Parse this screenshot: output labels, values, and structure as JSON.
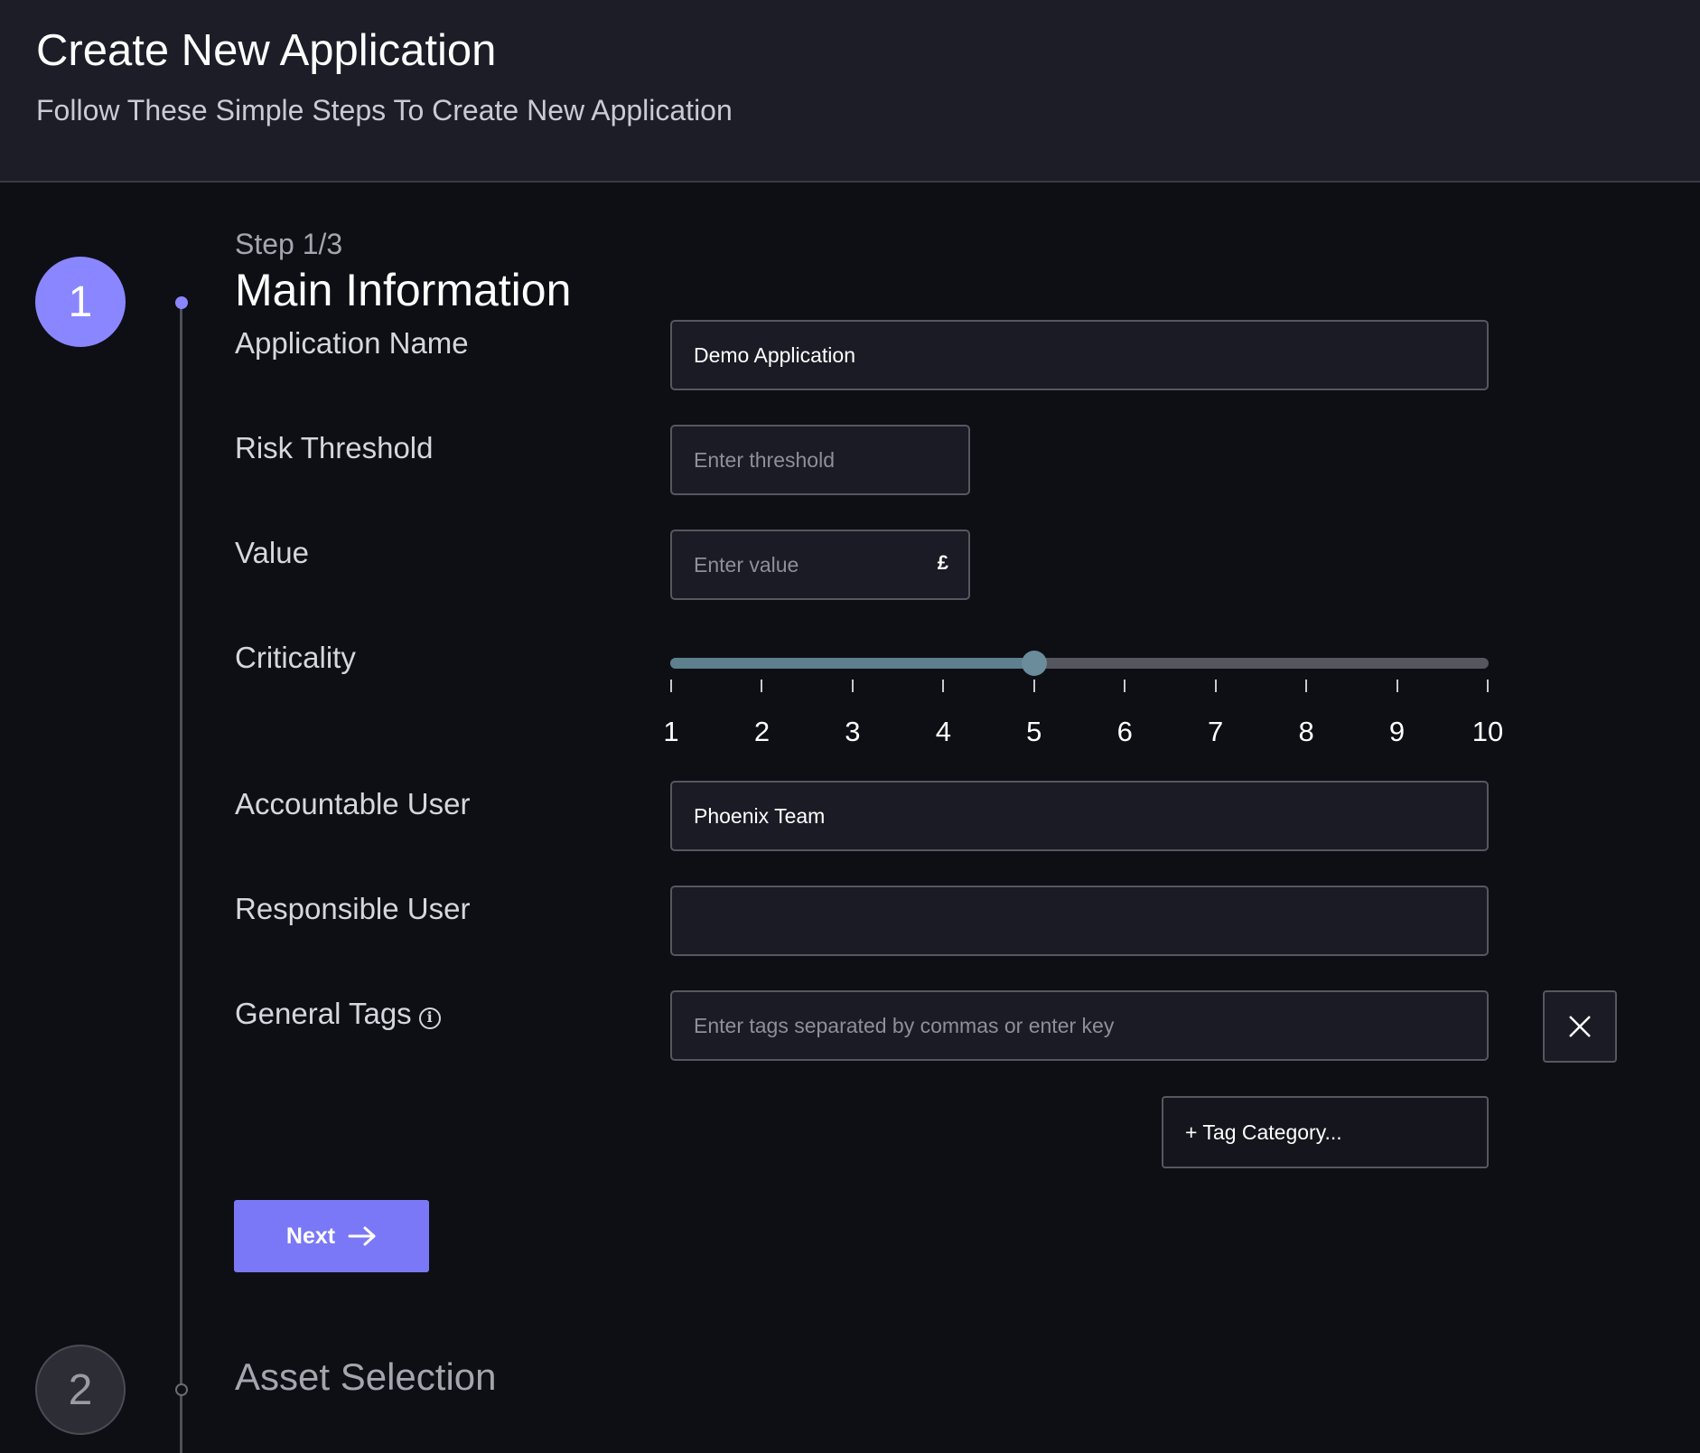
{
  "header": {
    "title": "Create New Application",
    "subtitle": "Follow These Simple Steps To Create New Application"
  },
  "stepper": {
    "active_step_number": "1",
    "counter": "Step 1/3",
    "active_step_title": "Main Information",
    "next_step_number": "2",
    "next_step_title": "Asset Selection"
  },
  "form": {
    "application_name": {
      "label": "Application Name",
      "value": "Demo Application",
      "placeholder": ""
    },
    "risk_threshold": {
      "label": "Risk Threshold",
      "value": "",
      "placeholder": "Enter threshold"
    },
    "value": {
      "label": "Value",
      "value": "",
      "placeholder": "Enter value",
      "currency_symbol": "£"
    },
    "criticality": {
      "label": "Criticality",
      "min": 1,
      "max": 10,
      "current": 5,
      "ticks": [
        "1",
        "2",
        "3",
        "4",
        "5",
        "6",
        "7",
        "8",
        "9",
        "10"
      ]
    },
    "accountable_user": {
      "label": "Accountable User",
      "value": "Phoenix Team"
    },
    "responsible_user": {
      "label": "Responsible User",
      "value": ""
    },
    "general_tags": {
      "label": "General Tags",
      "placeholder": "Enter tags separated by commas or enter key",
      "info_icon": "info-icon",
      "clear_icon": "close-icon",
      "tag_category_label": "+ Tag Category..."
    }
  },
  "actions": {
    "next_label": "Next",
    "next_icon": "arrow-right-icon"
  },
  "colors": {
    "accent": "#7b78f7",
    "slider_fill": "#5e7f8e",
    "header_bg": "#1c1d27",
    "page_bg": "#0e0f14"
  }
}
